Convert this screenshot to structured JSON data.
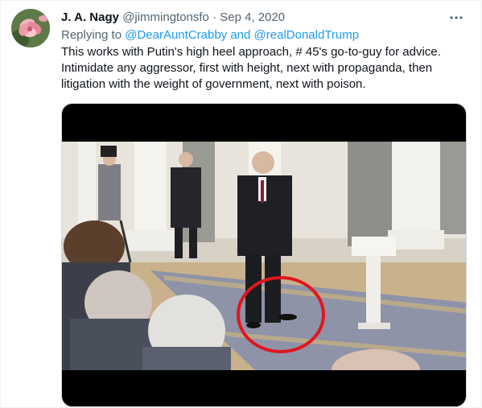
{
  "tweet": {
    "display_name": "J. A. Nagy",
    "handle": "@jimmingtonsfo",
    "separator": " · ",
    "date": "Sep 4, 2020",
    "more_icon": "more-horizontal-icon",
    "replying_prefix": "Replying to ",
    "replying_user_1": "@DearAuntCrabby",
    "replying_and": " and ",
    "replying_user_2": "@realDonaldTrump",
    "body": "This works with Putin's high heel approach, # 45's go-to-guy for advice. Intimidate any aggressor, first with height, next with propaganda, then litigation with the weight of government, next with poison.",
    "media": {
      "type": "video-still",
      "highlight_color": "#e0161c"
    }
  },
  "colors": {
    "text_primary": "#0f1419",
    "text_secondary": "#536471",
    "link": "#1d9bf0"
  }
}
